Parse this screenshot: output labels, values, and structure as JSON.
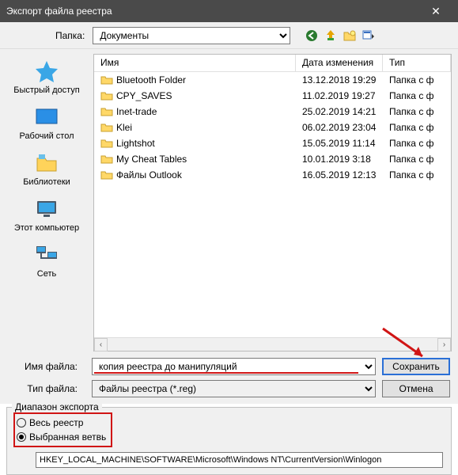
{
  "title": "Экспорт файла реестра",
  "toolbar": {
    "folder_label": "Папка:",
    "folder_value": "Документы"
  },
  "sidebar": [
    {
      "key": "quick",
      "label": "Быстрый доступ"
    },
    {
      "key": "desktop",
      "label": "Рабочий стол"
    },
    {
      "key": "libraries",
      "label": "Библиотеки"
    },
    {
      "key": "computer",
      "label": "Этот компьютер"
    },
    {
      "key": "network",
      "label": "Сеть"
    }
  ],
  "columns": {
    "name": "Имя",
    "date": "Дата изменения",
    "type": "Тип"
  },
  "files": [
    {
      "name": "Bluetooth Folder",
      "date": "13.12.2018 19:29",
      "type": "Папка с ф"
    },
    {
      "name": "CPY_SAVES",
      "date": "11.02.2019 19:27",
      "type": "Папка с ф"
    },
    {
      "name": "Inet-trade",
      "date": "25.02.2019 14:21",
      "type": "Папка с ф"
    },
    {
      "name": "Klei",
      "date": "06.02.2019 23:04",
      "type": "Папка с ф"
    },
    {
      "name": "Lightshot",
      "date": "15.05.2019 11:14",
      "type": "Папка с ф"
    },
    {
      "name": "My Cheat Tables",
      "date": "10.01.2019 3:18",
      "type": "Папка с ф"
    },
    {
      "name": "Файлы Outlook",
      "date": "16.05.2019 12:13",
      "type": "Папка с ф"
    }
  ],
  "fields": {
    "name_label": "Имя файла:",
    "name_value": "копия реестра до манипуляций",
    "type_label": "Тип файла:",
    "type_value": "Файлы реестра (*.reg)",
    "save": "Сохранить",
    "cancel": "Отмена"
  },
  "export": {
    "legend": "Диапазон экспорта",
    "all": "Весь реестр",
    "selected": "Выбранная ветвь",
    "path": "HKEY_LOCAL_MACHINE\\SOFTWARE\\Microsoft\\Windows NT\\CurrentVersion\\Winlogon"
  }
}
